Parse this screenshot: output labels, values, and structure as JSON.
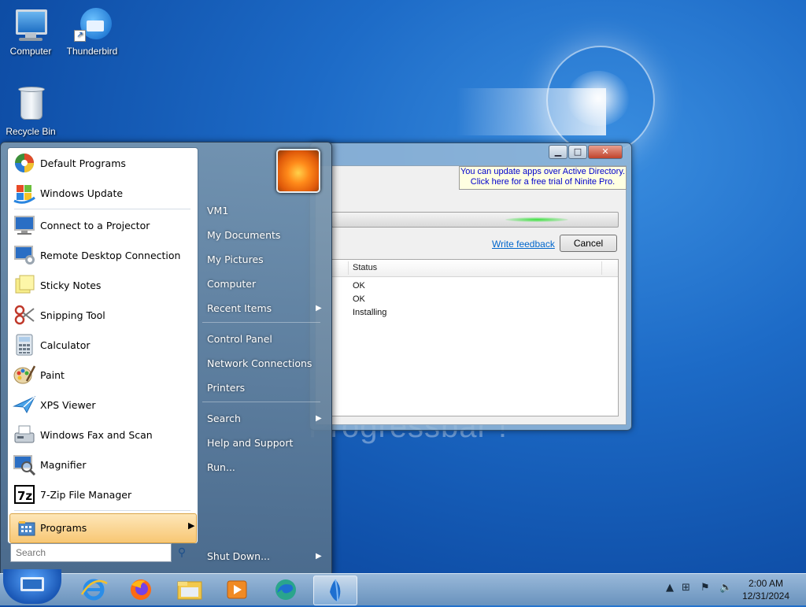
{
  "desktop": {
    "icons": [
      {
        "label": "Computer",
        "icon": "computer-icon"
      },
      {
        "label": "Thunderbird",
        "icon": "thunderbird-icon"
      },
      {
        "label": "Recycle Bin",
        "icon": "recycle-bin-icon"
      }
    ],
    "background_text": "Progressbar !"
  },
  "ninite_window": {
    "promo_line1": "You can update apps over Active Directory.",
    "promo_line2": "Click here for a free trial of Ninite Pro.",
    "feedback_link": "Write feedback",
    "cancel_label": "Cancel",
    "column_status": "Status",
    "rows": [
      {
        "status": "OK"
      },
      {
        "status": "OK"
      },
      {
        "status": "Installing"
      }
    ],
    "controls": {
      "minimize": "▁",
      "maximize": "□",
      "close": "✕"
    }
  },
  "start_menu": {
    "programs": [
      {
        "label": "Default Programs",
        "icon": "default-programs-icon"
      },
      {
        "label": "Windows Update",
        "icon": "windows-update-icon"
      },
      {
        "label": "Connect to a Projector",
        "icon": "projector-icon"
      },
      {
        "label": "Remote Desktop Connection",
        "icon": "remote-desktop-icon"
      },
      {
        "label": "Sticky Notes",
        "icon": "sticky-notes-icon"
      },
      {
        "label": "Snipping Tool",
        "icon": "snipping-tool-icon"
      },
      {
        "label": "Calculator",
        "icon": "calculator-icon"
      },
      {
        "label": "Paint",
        "icon": "paint-icon"
      },
      {
        "label": "XPS Viewer",
        "icon": "xps-viewer-icon"
      },
      {
        "label": "Windows Fax and Scan",
        "icon": "fax-scan-icon"
      },
      {
        "label": "Magnifier",
        "icon": "magnifier-icon"
      },
      {
        "label": "7-Zip File Manager",
        "icon": "7zip-icon"
      }
    ],
    "all_programs_label": "Programs",
    "search_placeholder": "Search",
    "right_items": [
      {
        "label": "VM1",
        "arrow": false
      },
      {
        "label": "My Documents",
        "arrow": false
      },
      {
        "label": "My Pictures",
        "arrow": false
      },
      {
        "label": "Computer",
        "arrow": false
      },
      {
        "label": "Recent Items",
        "arrow": true
      },
      {
        "label": "Control Panel",
        "arrow": false
      },
      {
        "label": "Network Connections",
        "arrow": false
      },
      {
        "label": "Printers",
        "arrow": false
      },
      {
        "label": "Search",
        "arrow": true
      },
      {
        "label": "Help and Support",
        "arrow": false
      },
      {
        "label": "Run...",
        "arrow": false
      }
    ],
    "shutdown_label": "Shut Down..."
  },
  "taskbar": {
    "pinned": [
      "internet-explorer-icon",
      "firefox-icon",
      "file-explorer-icon",
      "media-player-icon",
      "edge-icon",
      "ninite-icon"
    ],
    "tray_icons": [
      "show-hidden-icons",
      "network-icon",
      "action-center-flag-icon",
      "volume-muted-icon"
    ],
    "time": "2:00 AM",
    "date": "12/31/2024"
  }
}
